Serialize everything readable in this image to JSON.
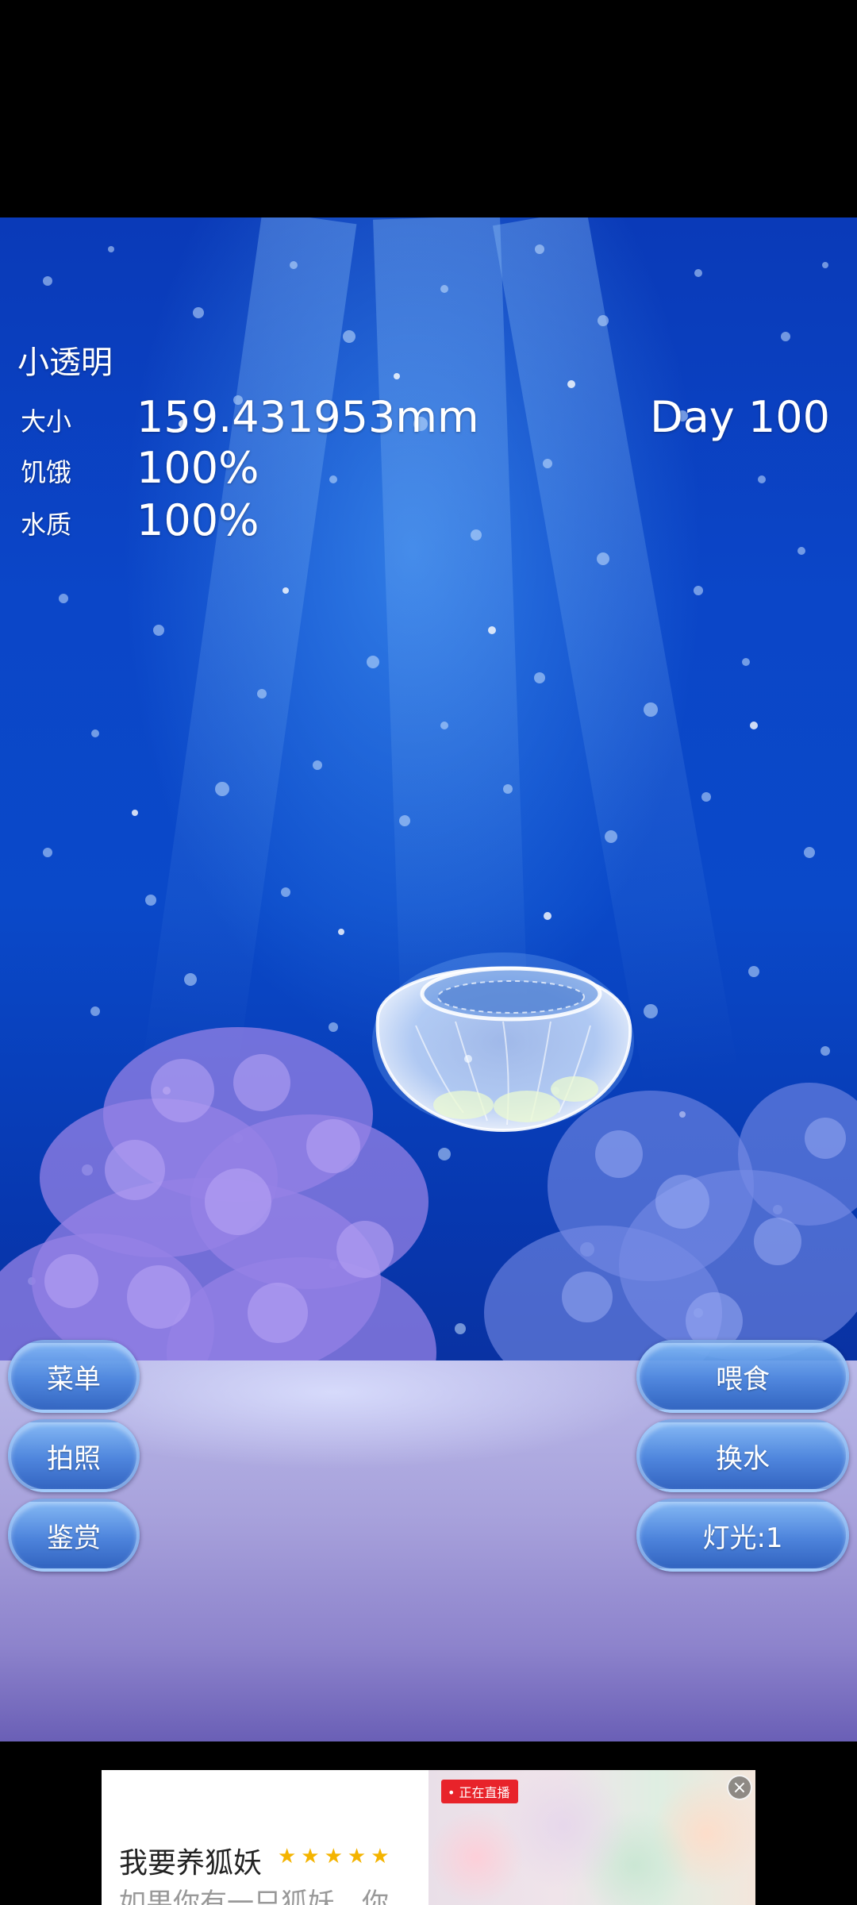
{
  "hud": {
    "pet_name": "小透明",
    "stats": {
      "size_label": "大小",
      "size_value": "159.431953mm",
      "hunger_label": "饥饿",
      "hunger_value": "100%",
      "water_label": "水质",
      "water_value": "100%"
    },
    "day": "Day 100"
  },
  "buttons": {
    "menu": "菜单",
    "photo": "拍照",
    "gallery": "鉴赏",
    "feed": "喂食",
    "change_water": "换水",
    "light": "灯光:1"
  },
  "ad": {
    "title": "我要养狐妖",
    "stars": "★★★★★",
    "description": "如果你有一只狐妖，你",
    "live_badge": "• 正在直播",
    "close_icon": "close-icon"
  },
  "colors": {
    "water_top": "#0a3ab8",
    "water_bottom": "#1a2e8e",
    "button": "#5a9be6",
    "sand": "#a8a2dc",
    "ad_badge": "#e8232a",
    "star": "#f4b400"
  }
}
